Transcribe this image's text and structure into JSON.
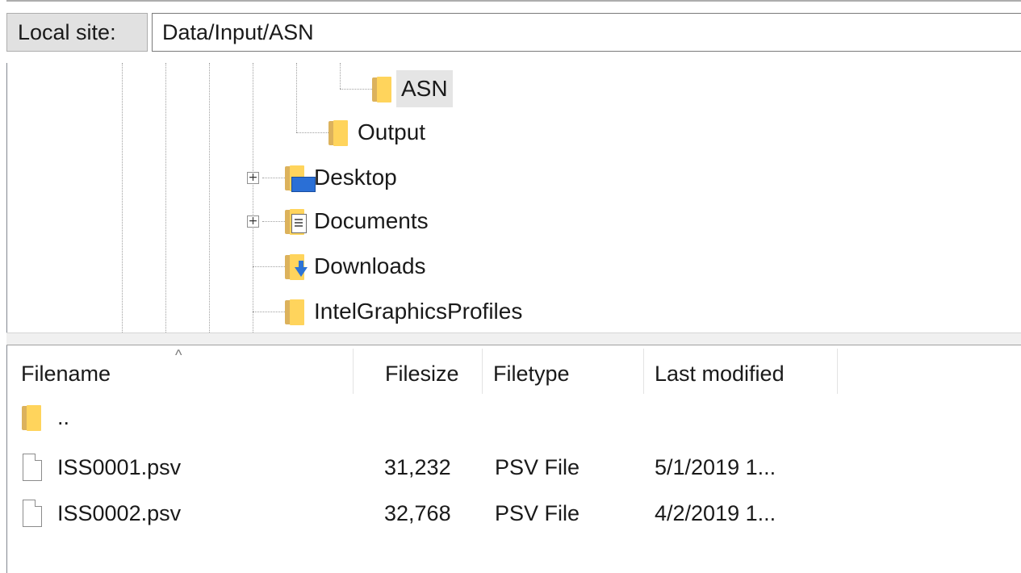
{
  "path_bar": {
    "label": "Local site:",
    "value": "Data/Input/ASN"
  },
  "tree": {
    "nodes": [
      {
        "label": "ASN",
        "icon": "folder-icon",
        "selected": true
      },
      {
        "label": "Output",
        "icon": "folder-icon"
      },
      {
        "label": "Desktop",
        "icon": "desktop-folder-icon",
        "expandable": "+"
      },
      {
        "label": "Documents",
        "icon": "documents-folder-icon",
        "expandable": "+"
      },
      {
        "label": "Downloads",
        "icon": "downloads-folder-icon"
      },
      {
        "label": "IntelGraphicsProfiles",
        "icon": "folder-icon"
      }
    ]
  },
  "file_list": {
    "columns": [
      "Filename",
      "Filesize",
      "Filetype",
      "Last modified"
    ],
    "sort_indicator": "^",
    "rows": [
      {
        "name": "..",
        "icon": "folder-icon",
        "size": "",
        "type": "",
        "modified": ""
      },
      {
        "name": "ISS0001.psv",
        "icon": "file-icon",
        "size": "31,232",
        "type": "PSV File",
        "modified": "5/1/2019 1..."
      },
      {
        "name": "ISS0002.psv",
        "icon": "file-icon",
        "size": "32,768",
        "type": "PSV File",
        "modified": "4/2/2019 1..."
      }
    ]
  },
  "colors": {
    "selection": "#e5e5e5",
    "folder": "#ffd45c",
    "folder_back": "#dcb25c",
    "accent_blue": "#2a6fd6"
  }
}
